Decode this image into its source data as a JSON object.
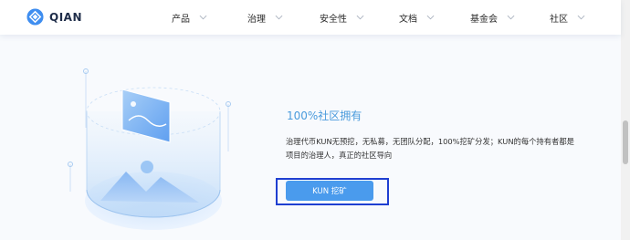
{
  "brand": {
    "name": "QIAN"
  },
  "nav": {
    "items": [
      {
        "label": "产品"
      },
      {
        "label": "治理"
      },
      {
        "label": "安全性"
      },
      {
        "label": "文档"
      },
      {
        "label": "基金会"
      },
      {
        "label": "社区"
      }
    ]
  },
  "section": {
    "title": "100%社区拥有",
    "description_line1": "治理代币KUN无预挖，无私募，无团队分配，100%挖矿分发；KUN的每个持有者都是",
    "description_line2": "项目的治理人，真正的社区导向",
    "cta_label": "KUN 挖矿"
  },
  "colors": {
    "accent": "#4a9bed",
    "title": "#4a9bdc",
    "highlight_border": "#1f3fd1"
  }
}
